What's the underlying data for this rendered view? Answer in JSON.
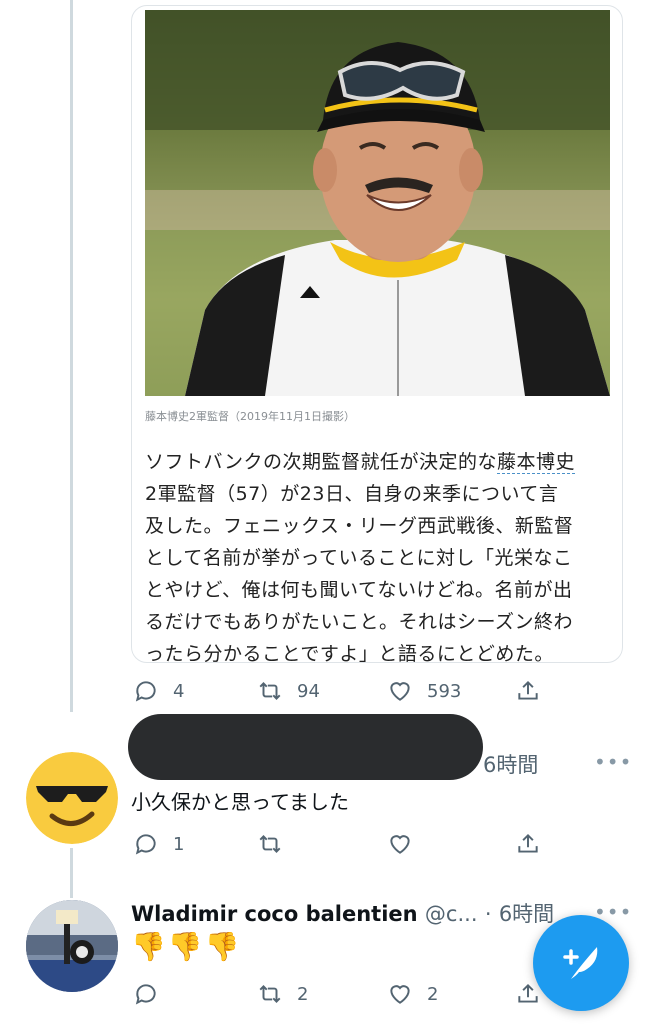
{
  "quoted_tweet": {
    "caption": "藤本博史2軍監督（2019年11月1日撮影）",
    "article_lines": [
      "ソフトバンクの次期監督就任が決定的な藤本博史",
      "2軍監督（57）が23日、自身の来季について言",
      "及した。フェニックス・リーグ西武戦後、新監督",
      "として名前が挙がっていることに対し「光栄なこ",
      "とやけど、俺は何も聞いてないけどね。名前が出",
      "るだけでもありがたいこと。それはシーズン終わ",
      "ったら分かることですよ」と語るにとどめた。"
    ],
    "article_line1_plain": "ソフトバンクの次期監督就任が決定的な",
    "article_line1_link": "藤本博史",
    "cap_logo": "Majestic",
    "replies": "4",
    "retweets": "94",
    "likes": "593"
  },
  "reply1": {
    "time": "6時間",
    "more": "•••",
    "text": "小久保かと思ってました",
    "replies": "1",
    "retweets": "",
    "likes": ""
  },
  "reply2": {
    "display_name": "Wladimir coco balentien",
    "handle": "@c...",
    "time_sep": "·",
    "time": "6時間",
    "more": "•••",
    "emojis": "👎👎👎",
    "replies": "",
    "retweets": "2",
    "likes": "2"
  },
  "colors": {
    "accent": "#1d9bf0",
    "action_gray": "#536471",
    "thread_line": "#cfd9de",
    "redaction": "#2a2c2e"
  },
  "icons": [
    "reply-icon",
    "retweet-icon",
    "like-icon",
    "share-icon",
    "sunglasses-emoji-icon",
    "compose-tweet-icon"
  ]
}
